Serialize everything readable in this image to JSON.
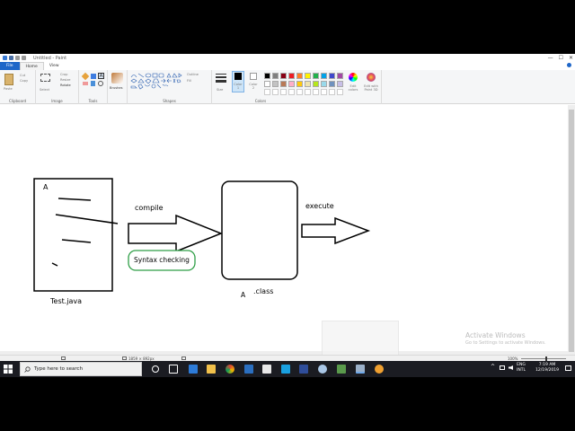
{
  "window": {
    "title": "Untitled - Paint",
    "min": "—",
    "max": "☐",
    "close": "✕"
  },
  "tabs": {
    "file": "File",
    "home": "Home",
    "view": "View"
  },
  "ribbon": {
    "clipboard": {
      "label": "Clipboard",
      "paste": "Paste",
      "cut": "Cut",
      "copy": "Copy"
    },
    "image": {
      "label": "Image",
      "select": "Select",
      "crop": "Crop",
      "resize": "Resize",
      "rotate": "Rotate"
    },
    "tools": {
      "label": "Tools"
    },
    "brushes": "Brushes",
    "shapes": {
      "label": "Shapes",
      "outline": "Outline",
      "fill": "Fill"
    },
    "size": "Size",
    "color1": "Color 1",
    "color2": "Color 2",
    "colors": {
      "label": "Colors",
      "edit": "Edit colors",
      "paint3d": "Edit with Paint 3D"
    }
  },
  "palette": [
    "#000000",
    "#7f7f7f",
    "#880015",
    "#ed1c24",
    "#ff7f27",
    "#fff200",
    "#22b14c",
    "#00a2e8",
    "#3f48cc",
    "#a349a4",
    "#ffffff",
    "#c3c3c3",
    "#b97a57",
    "#ffaec9",
    "#ffc90e",
    "#efe4b0",
    "#b5e61d",
    "#99d9ea",
    "#7092be",
    "#c8bfe7"
  ],
  "canvas": {
    "box_letter": "A",
    "file_label": "Test.java",
    "compile": "compile",
    "syntax": "Syntax checking",
    "class_letter": "A",
    "class_label": ".class",
    "execute": "execute"
  },
  "status": {
    "dimensions": "1859 × 892px",
    "zoom": "100%"
  },
  "watermark": {
    "title": "Activate Windows",
    "subtitle": "Go to Settings to activate Windows."
  },
  "taskbar": {
    "search_placeholder": "Type here to search",
    "lang": "ENG",
    "lang2": "INTL",
    "time": "7:19 AM",
    "date": "12/19/2019"
  }
}
